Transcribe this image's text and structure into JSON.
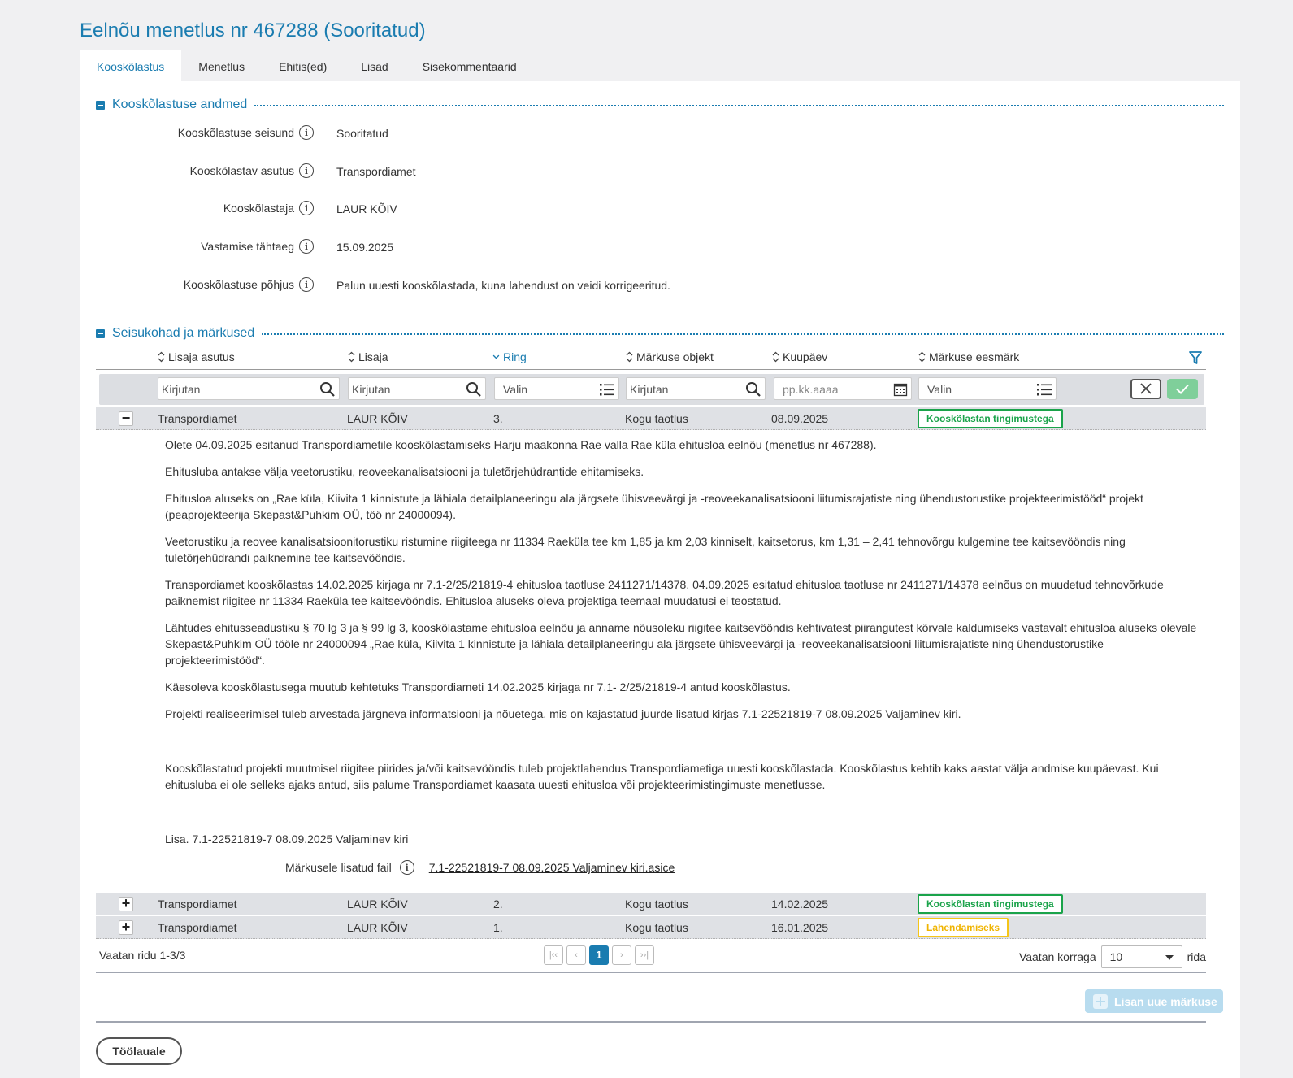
{
  "page_title": "Eelnõu menetlus nr 467288 (Sooritatud)",
  "tabs": [
    "Kooskõlastus",
    "Menetlus",
    "Ehitis(ed)",
    "Lisad",
    "Sisekommentaarid"
  ],
  "section1": {
    "title": "Kooskõlastuse andmed",
    "fields": [
      {
        "label": "Kooskõlastuse seisund",
        "value": "Sooritatud"
      },
      {
        "label": "Kooskõlastav asutus",
        "value": "Transpordiamet"
      },
      {
        "label": "Kooskõlastaja",
        "value": "LAUR KÕIV"
      },
      {
        "label": "Vastamise tähtaeg",
        "value": "15.09.2025"
      },
      {
        "label": "Kooskõlastuse põhjus",
        "value": "Palun uuesti kooskõlastada, kuna lahendust on veidi korrigeeritud."
      }
    ]
  },
  "section2": {
    "title": "Seisukohad ja märkused",
    "columns": [
      "Lisaja asutus",
      "Lisaja",
      "Ring",
      "Märkuse objekt",
      "Kuupäev",
      "Märkuse eesmärk"
    ],
    "filters": {
      "asutus": "Kirjutan",
      "lisaja": "Kirjutan",
      "ring": "Valin",
      "objekt": "Kirjutan",
      "kuupaev": "pp.kk.aaaa",
      "eesmark": "Valin"
    },
    "rows": [
      {
        "toggle": "−",
        "asutus": "Transpordiamet",
        "lisaja": "LAUR KÕIV",
        "ring": "3.",
        "objekt": "Kogu taotlus",
        "kuupaev": "08.09.2025",
        "eesmark": "Kooskõlastan tingimustega"
      },
      {
        "toggle": "+",
        "asutus": "Transpordiamet",
        "lisaja": "LAUR KÕIV",
        "ring": "2.",
        "objekt": "Kogu taotlus",
        "kuupaev": "14.02.2025",
        "eesmark": "Kooskõlastan tingimustega"
      },
      {
        "toggle": "+",
        "asutus": "Transpordiamet",
        "lisaja": "LAUR KÕIV",
        "ring": "1.",
        "objekt": "Kogu taotlus",
        "kuupaev": "16.01.2025",
        "eesmark": "Lahendamiseks"
      }
    ],
    "detail_paragraphs": [
      "Olete 04.09.2025 esitanud Transpordiametile kooskõlastamiseks Harju maakonna Rae valla Rae küla ehitusloa eelnõu (menetlus nr 467288).",
      "Ehitusluba antakse välja veetorustiku, reoveekanalisatsiooni ja tuletõrjehüdrantide ehitamiseks.",
      "Ehitusloa aluseks on „Rae küla, Kiivita 1 kinnistute ja lähiala detailplaneeringu ala järgsete ühisveevärgi ja -reoveekanalisatsiooni liitumisrajatiste ning ühendustorustike projekteerimistööd“ projekt (peaprojekteerija Skepast&Puhkim OÜ, töö nr 24000094).",
      "Veetorustiku ja reovee kanalisatsioonitorustiku ristumine riigiteega nr 11334 Raeküla tee km 1,85 ja km 2,03 kinniselt, kaitsetorus, km 1,31 – 2,41 tehnovõrgu kulgemine tee kaitsevööndis ning tuletõrjehüdrandi paiknemine tee kaitsevööndis.",
      "Transpordiamet kooskõlastas 14.02.2025 kirjaga nr 7.1-2/25/21819-4 ehitusloa taotluse 2411271/14378. 04.09.2025 esitatud ehitusloa taotluse nr 2411271/14378 eelnõus on muudetud tehnovõrkude paiknemist riigitee nr 11334 Raeküla tee kaitsevööndis. Ehitusloa aluseks oleva projektiga teemaal muudatusi ei teostatud.",
      "Lähtudes ehitusseadustiku § 70 lg 3 ja § 99 lg 3, kooskõlastame ehitusloa eelnõu ja anname nõusoleku riigitee kaitsevööndis kehtivatest piirangutest kõrvale kaldumiseks vastavalt ehitusloa aluseks olevale Skepast&Puhkim OÜ tööle nr 24000094 „Rae küla, Kiivita 1 kinnistute ja lähiala detailplaneeringu ala järgsete ühisveevärgi ja -reoveekanalisatsiooni liitumisrajatiste ning ühendustorustike projekteerimistööd“.",
      "Käesoleva kooskõlastusega muutub kehtetuks Transpordiameti 14.02.2025 kirjaga nr 7.1- 2/25/21819-4 antud kooskõlastus.",
      "Projekti realiseerimisel tuleb arvestada järgneva informatsiooni ja nõuetega, mis on kajastatud juurde lisatud kirjas 7.1-22521819-7 08.09.2025 Valjaminev kiri.",
      "Kooskõlastatud projekti muutmisel riigitee piirides ja/või kaitsevööndis tuleb projektlahendus Transpordiametiga uuesti kooskõlastada. Kooskõlastus kehtib kaks aastat välja andmise kuupäevast. Kui ehitusluba ei ole selleks ajaks antud, siis palume Transpordiamet kaasata uuesti ehitusloa või projekteerimistingimuste menetlusse.",
      "Lisa. 7.1-22521819-7 08.09.2025 Valjaminev kiri"
    ],
    "attachment_label": "Märkusele lisatud fail",
    "attachment_link": "7.1-22521819-7 08.09.2025 Valjaminev kiri.asice",
    "pager": {
      "count_text": "Vaatan ridu 1-3/3",
      "first": "|‹‹",
      "prev": "‹",
      "current": "1",
      "next": "›",
      "last": "››|",
      "per_page_label": "Vaatan korraga",
      "per_page_value": "10",
      "per_page_suffix": "rida"
    },
    "add_button": "Lisan uue märkuse"
  },
  "back_button": "Töölauale",
  "colors": {
    "accent": "#1a7cb0",
    "green": "#1aa34a",
    "yellow": "#f5c518"
  }
}
